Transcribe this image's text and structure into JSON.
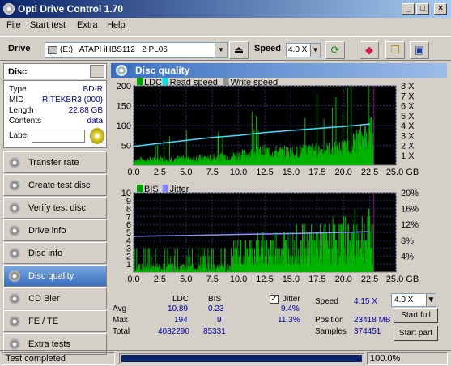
{
  "window": {
    "title": "Opti Drive Control 1.70"
  },
  "menu": [
    "File",
    "Start test",
    "Extra",
    "Help"
  ],
  "toolbar": {
    "drive_label": "Drive",
    "drive_value": "(E:)   ATAPI iHBS112   2 PL06",
    "speed_label": "Speed",
    "speed_value": "4.0 X"
  },
  "disc": {
    "header": "Disc",
    "type_label": "Type",
    "type_value": "BD-R",
    "mid_label": "MID",
    "mid_value": "RITEKBR3 (000)",
    "length_label": "Length",
    "length_value": "22.88 GB",
    "contents_label": "Contents",
    "contents_value": "data",
    "label_label": "Label"
  },
  "nav": [
    "Transfer rate",
    "Create test disc",
    "Verify test disc",
    "Drive info",
    "Disc info",
    "Disc quality",
    "CD Bler",
    "FE / TE",
    "Extra tests"
  ],
  "nav_active": 5,
  "panel_title": "Disc quality",
  "chart_data": [
    {
      "type": "bar",
      "legend": [
        "LDC",
        "Read speed",
        "Write speed"
      ],
      "legend_colors": [
        "#00a000",
        "#00e0e0",
        "#909090"
      ],
      "x_ticks": [
        "0.0",
        "2.5",
        "5.0",
        "7.5",
        "10.0",
        "12.5",
        "15.0",
        "17.5",
        "20.0",
        "22.5",
        "25.0 GB"
      ],
      "y_left_ticks": [
        "200",
        "150",
        "100",
        "50"
      ],
      "y_right_ticks": [
        "8 X",
        "7 X",
        "6 X",
        "5 X",
        "4 X",
        "3 X",
        "2 X",
        "1 X"
      ],
      "xlim": [
        0,
        25
      ],
      "ylim": [
        0,
        200
      ],
      "ldc_profile": [
        [
          0,
          15
        ],
        [
          2.5,
          18
        ],
        [
          5,
          20
        ],
        [
          7.5,
          22
        ],
        [
          10,
          30
        ],
        [
          12.5,
          40
        ],
        [
          15,
          38
        ],
        [
          17.5,
          45
        ],
        [
          20,
          50
        ],
        [
          22.5,
          95
        ]
      ],
      "read_speed": [
        [
          0,
          1.9
        ],
        [
          2.5,
          2.2
        ],
        [
          5,
          2.5
        ],
        [
          7.5,
          2.8
        ],
        [
          10,
          3.0
        ],
        [
          12.5,
          3.3
        ],
        [
          15,
          3.5
        ],
        [
          17.5,
          3.7
        ],
        [
          20,
          3.9
        ],
        [
          22.5,
          4.15
        ]
      ]
    },
    {
      "type": "bar",
      "legend": [
        "BIS",
        "Jitter"
      ],
      "legend_colors": [
        "#00a000",
        "#8080ff"
      ],
      "x_ticks": [
        "0.0",
        "2.5",
        "5.0",
        "7.5",
        "10.0",
        "12.5",
        "15.0",
        "17.5",
        "20.0",
        "22.5",
        "25.0 GB"
      ],
      "y_left_ticks": [
        "10",
        "9",
        "8",
        "7",
        "6",
        "5",
        "4",
        "3",
        "2",
        "1"
      ],
      "y_right_ticks": [
        "20%",
        "16%",
        "12%",
        "8%",
        "4%"
      ],
      "xlim": [
        0,
        25
      ],
      "ylim": [
        0,
        10
      ],
      "bis_profile": [
        [
          0,
          1
        ],
        [
          5,
          1
        ],
        [
          10,
          3
        ],
        [
          12.5,
          3.5
        ],
        [
          15,
          4
        ],
        [
          17.5,
          4.5
        ],
        [
          20,
          5
        ],
        [
          22.5,
          6
        ]
      ],
      "jitter": [
        [
          0,
          9.0
        ],
        [
          5,
          9.2
        ],
        [
          10,
          9.5
        ],
        [
          15,
          9.7
        ],
        [
          20,
          10.0
        ],
        [
          22.5,
          10.2
        ]
      ]
    }
  ],
  "stats": {
    "col_ldc": "LDC",
    "col_bis": "BIS",
    "jitter_label": "Jitter",
    "avg_label": "Avg",
    "max_label": "Max",
    "total_label": "Total",
    "avg_ldc": "10.89",
    "avg_bis": "0.23",
    "avg_jitter": "9.4%",
    "max_ldc": "194",
    "max_bis": "9",
    "max_jitter": "11.3%",
    "total_ldc": "4082290",
    "total_bis": "85331",
    "speed_label": "Speed",
    "speed_value": "4.15 X",
    "position_label": "Position",
    "position_value": "23418 MB",
    "samples_label": "Samples",
    "samples_value": "374451",
    "speed_select": "4.0 X",
    "start_full": "Start full",
    "start_part": "Start part"
  },
  "status": {
    "text": "Test completed",
    "percent": "100.0%",
    "progress": 1.0
  }
}
